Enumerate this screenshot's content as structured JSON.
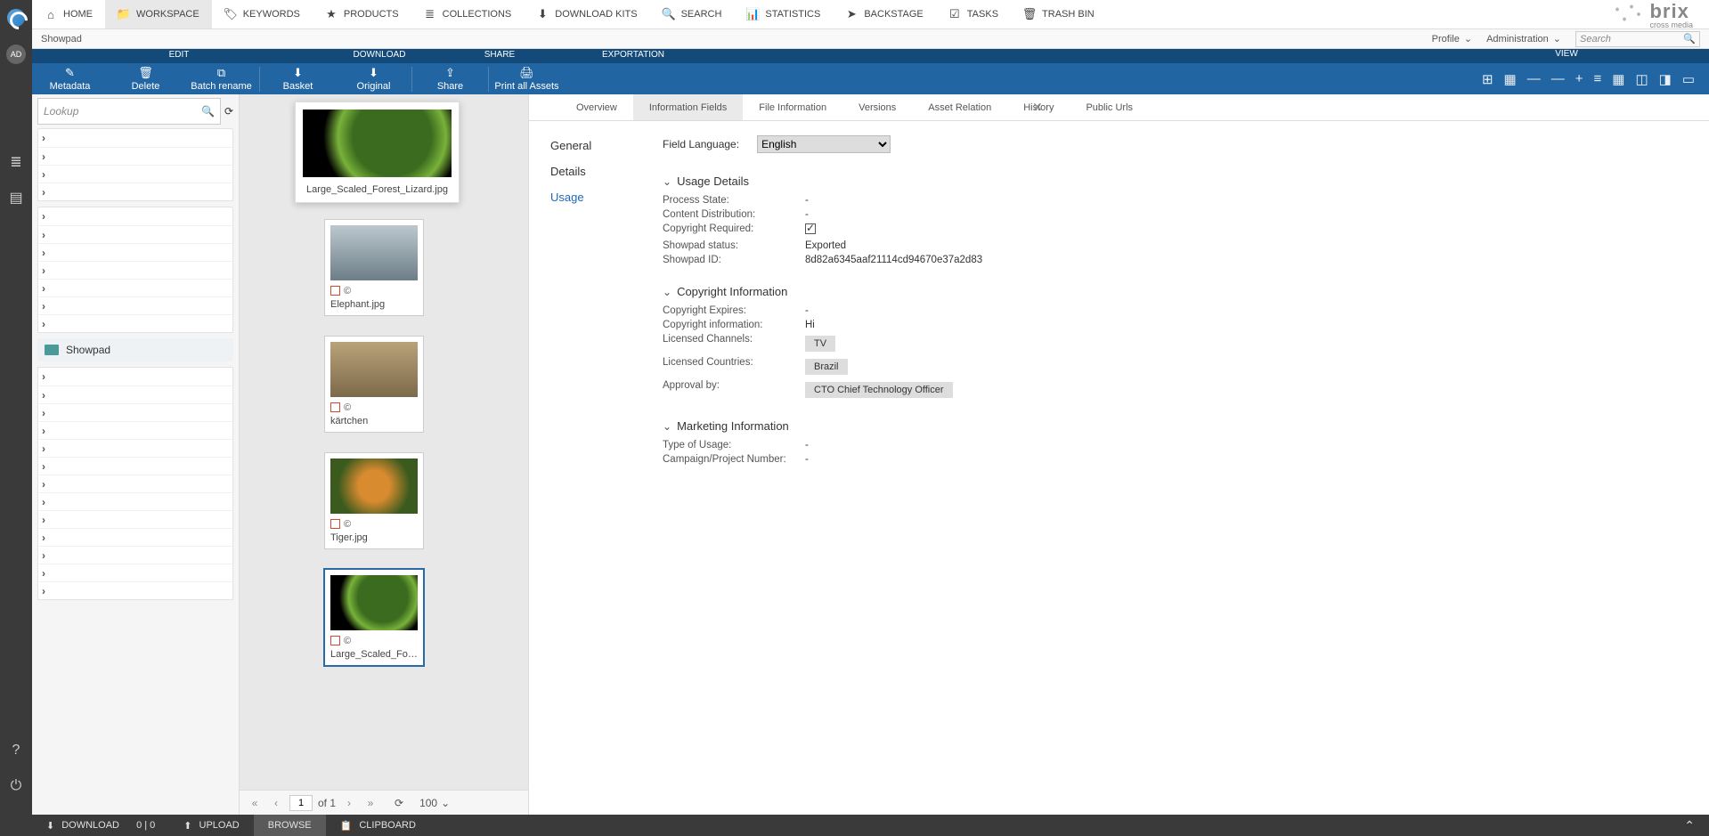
{
  "topnav": {
    "items": [
      {
        "icon": "⌂",
        "label": "HOME"
      },
      {
        "icon": "📁",
        "label": "WORKSPACE",
        "active": true
      },
      {
        "icon": "🏷",
        "label": "KEYWORDS"
      },
      {
        "icon": "★",
        "label": "PRODUCTS"
      },
      {
        "icon": "≣",
        "label": "COLLECTIONS"
      },
      {
        "icon": "⬇",
        "label": "DOWNLOAD KITS"
      },
      {
        "icon": "🔍",
        "label": "SEARCH"
      },
      {
        "icon": "📊",
        "label": "STATISTICS"
      },
      {
        "icon": "➤",
        "label": "BACKSTAGE"
      },
      {
        "icon": "☑",
        "label": "TASKS"
      },
      {
        "icon": "🗑",
        "label": "TRASH BIN"
      }
    ],
    "brand_name": "brix",
    "brand_sub": "cross media"
  },
  "context": {
    "breadcrumb": "Showpad",
    "profile": "Profile",
    "admin": "Administration",
    "search_placeholder": "Search"
  },
  "ribbon": {
    "headers": {
      "edit": "EDIT",
      "download": "DOWNLOAD",
      "share": "SHARE",
      "export": "EXPORTATION",
      "view": "VIEW"
    },
    "buttons": [
      {
        "label": "Metadata",
        "icon": "✎"
      },
      {
        "label": "Delete",
        "icon": "🗑"
      },
      {
        "label": "Batch rename",
        "icon": "⧉"
      },
      {
        "label": "Basket",
        "icon": "⬇"
      },
      {
        "label": "Original",
        "icon": "⬇"
      },
      {
        "label": "Share",
        "icon": "⇪"
      },
      {
        "label": "Print all Assets",
        "icon": "🖨"
      }
    ]
  },
  "tree": {
    "lookup_placeholder": "Lookup",
    "folder": "Showpad"
  },
  "preview": {
    "caption": "Large_Scaled_Forest_Lizard.jpg"
  },
  "assets": [
    {
      "name": "Elephant.jpg",
      "cls": "eleph"
    },
    {
      "name": "kärtchen",
      "cls": "card"
    },
    {
      "name": "Tiger.jpg",
      "cls": "tiger"
    },
    {
      "name": "Large_Scaled_Fores...",
      "cls": "lizard",
      "selected": true
    }
  ],
  "pager": {
    "page": "1",
    "of": "of 1",
    "size": "100"
  },
  "detail": {
    "tabs": [
      "Overview",
      "Information Fields",
      "File Information",
      "Versions",
      "Asset Relation",
      "History",
      "Public Urls"
    ],
    "active_tab": 1,
    "side": [
      "General",
      "Details",
      "Usage"
    ],
    "active_side": 2,
    "field_language_label": "Field Language:",
    "field_language_value": "English",
    "groups": {
      "usage": {
        "title": "Usage Details",
        "process_state_l": "Process State:",
        "process_state_v": "-",
        "content_dist_l": "Content Distribution:",
        "content_dist_v": "-",
        "copyright_req_l": "Copyright Required:",
        "copyright_req_v": true,
        "showpad_status_l": "Showpad status:",
        "showpad_status_v": "Exported",
        "showpad_id_l": "Showpad ID:",
        "showpad_id_v": "8d82a6345aaf21114cd94670e37a2d83"
      },
      "copyright": {
        "title": "Copyright Information",
        "expires_l": "Copyright Expires:",
        "expires_v": "-",
        "info_l": "Copyright information:",
        "info_v": "Hi",
        "channels_l": "Licensed Channels:",
        "channels_v": "TV",
        "countries_l": "Licensed Countries:",
        "countries_v": "Brazil",
        "approval_l": "Approval by:",
        "approval_v": "CTO Chief Technology Officer"
      },
      "marketing": {
        "title": "Marketing Information",
        "type_l": "Type of Usage:",
        "type_v": "-",
        "campaign_l": "Campaign/Project Number:",
        "campaign_v": "-"
      }
    }
  },
  "bottom": {
    "download": "DOWNLOAD",
    "download_count": "0 | 0",
    "upload": "UPLOAD",
    "browse": "BROWSE",
    "clipboard": "CLIPBOARD"
  },
  "rail_avatar": "AD"
}
